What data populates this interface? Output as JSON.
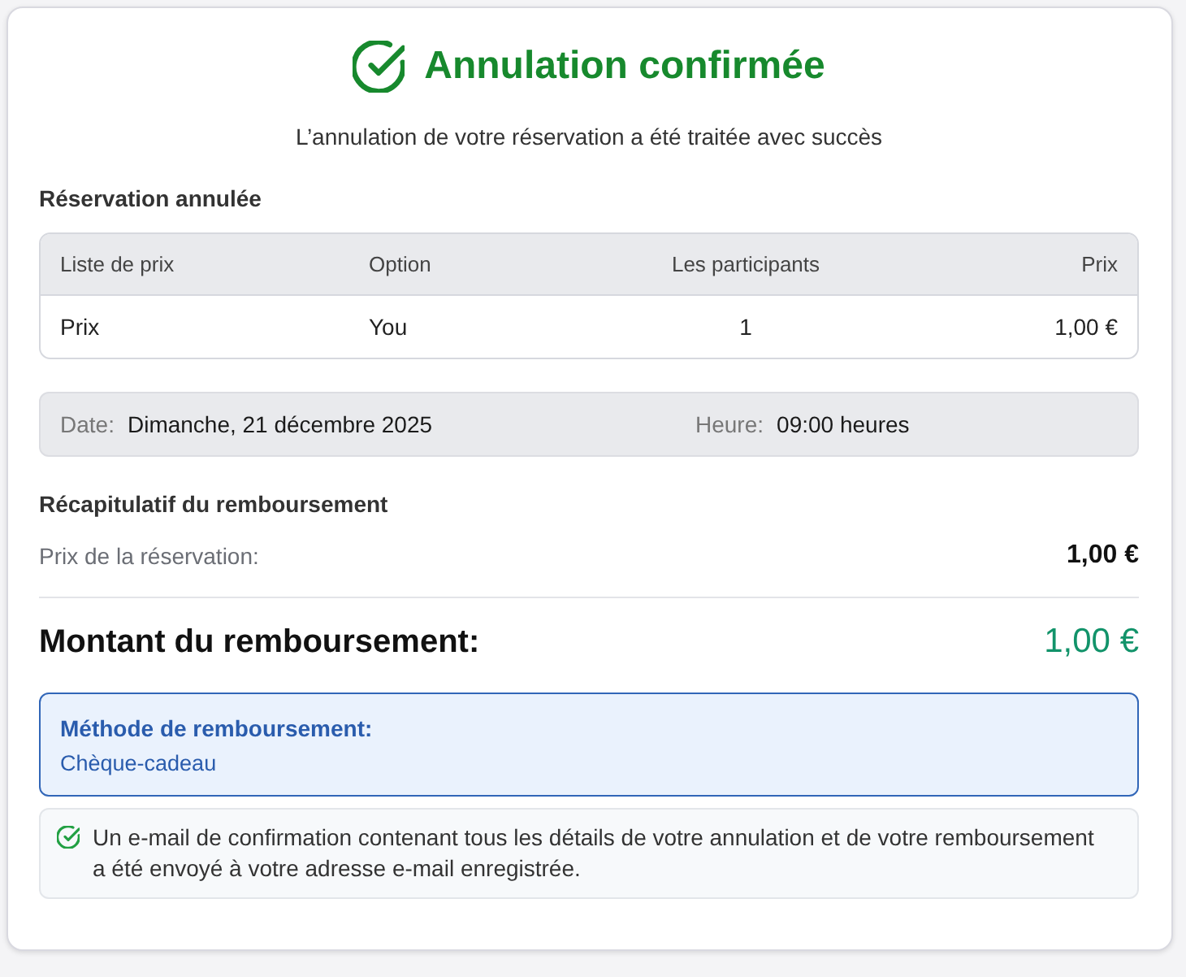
{
  "header": {
    "title": "Annulation confirmée",
    "subtitle": "L’annulation de votre réservation a été traitée avec succès"
  },
  "booking": {
    "heading": "Réservation annulée",
    "table": {
      "columns": [
        "Liste de prix",
        "Option",
        "Les participants",
        "Prix"
      ],
      "rows": [
        [
          "Prix",
          "You",
          "1",
          "1,00 €"
        ]
      ]
    }
  },
  "schedule": [
    {
      "label": "Date:",
      "value": "Dimanche, 21 décembre 2025"
    },
    {
      "label": "Heure:",
      "value": "09:00 heures"
    }
  ],
  "refund_summary": {
    "heading": "Récapitulatif du remboursement",
    "lines": [
      {
        "label": "Prix de la réservation:",
        "value": "1,00 €"
      }
    ],
    "total": {
      "label": "Montant du remboursement:",
      "value": "1,00 €"
    }
  },
  "refund_method": {
    "label": "Méthode de remboursement:",
    "value": "Chèque-cadeau"
  },
  "notice": {
    "text": "Un e-mail de confirmation contenant tous les détails de votre annulation et de votre remboursement a été envoyé à votre adresse e-mail enregistrée."
  }
}
